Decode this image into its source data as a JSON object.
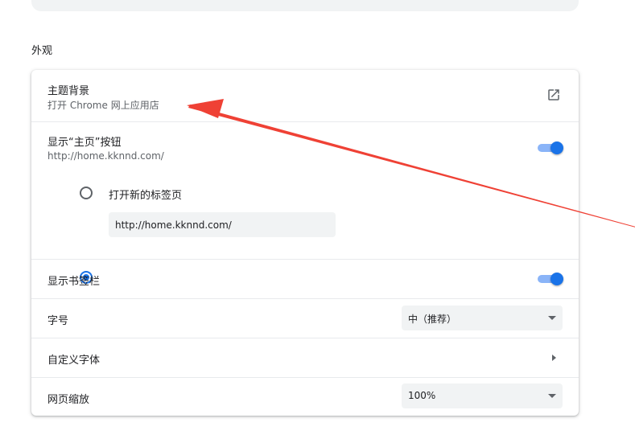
{
  "appearance": {
    "section_title": "外观",
    "theme": {
      "title": "主题背景",
      "subtitle": "打开 Chrome 网上应用店",
      "icon": "open-in-new-icon"
    },
    "home_button": {
      "title": "显示“主页”按钮",
      "subtitle": "http://home.kknnd.com/",
      "enabled": true,
      "options": [
        {
          "label": "打开新的标签页",
          "selected": false
        },
        {
          "label": "",
          "selected": true
        }
      ],
      "custom_url_value": "http://home.kknnd.com/"
    },
    "bookmarks_bar": {
      "title": "显示书签栏",
      "enabled": true
    },
    "font_size": {
      "title": "字号",
      "value": "中（推荐）"
    },
    "custom_fonts": {
      "title": "自定义字体"
    },
    "page_zoom": {
      "title": "网页缩放",
      "value": "100%"
    }
  },
  "colors": {
    "accent": "#1a73e8",
    "toggle_track": "#8ab4f8",
    "annotation": "#ef4135"
  }
}
